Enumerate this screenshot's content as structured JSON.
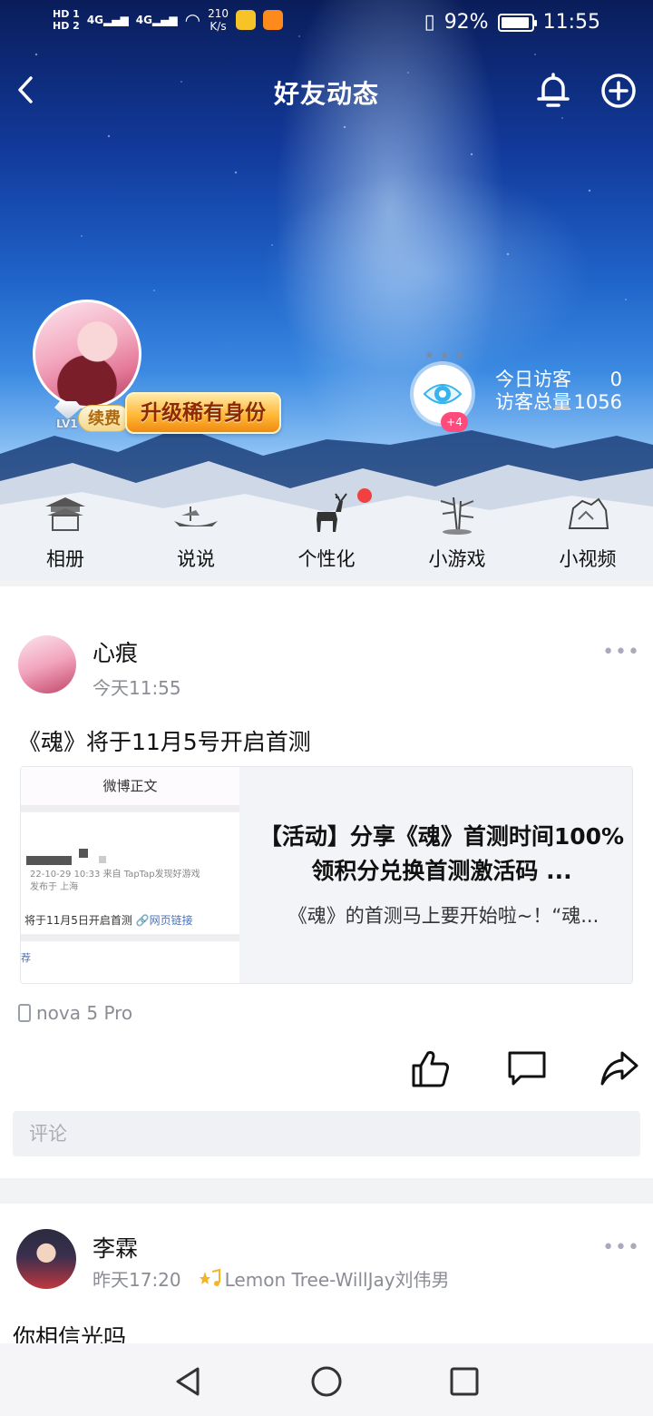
{
  "status_bar": {
    "hd1": "HD 1",
    "hd2": "HD 2",
    "sig1": "4G",
    "sig2": "4G",
    "speed_value": "210",
    "speed_unit": "K/s",
    "battery_pct": "92%",
    "time": "11:55"
  },
  "nav": {
    "title": "好友动态"
  },
  "profile": {
    "level": "LV1",
    "renew_label": "续费",
    "upgrade_label": "升级稀有身份",
    "eye_badge": "+4",
    "today_visitors_label": "今日访客",
    "today_visitors_value": "0",
    "total_visitors_label": "访客总量",
    "total_visitors_value": "1056"
  },
  "categories": [
    {
      "label": "相册"
    },
    {
      "label": "说说"
    },
    {
      "label": "个性化"
    },
    {
      "label": "小游戏"
    },
    {
      "label": "小视频"
    }
  ],
  "post1": {
    "author": "心痕",
    "time": "今天11:55",
    "text": "《魂》将于11月5号开启首测",
    "link": {
      "thumb_header": "微博正文",
      "thumb_meta_1": "22-10-29 10:33  来自 TapTap发现好游戏",
      "thumb_meta_2": "发布于 上海",
      "thumb_line": "将于11月5日开启首测",
      "thumb_link": "🔗网页链接",
      "thumb_rec": "荐",
      "title": "【活动】分享《魂》首测时间100%领积分兑换首测激活码 ...",
      "desc": "《魂》的首测马上要开始啦~！“魂..."
    },
    "device": "nova 5 Pro",
    "comment_placeholder": "评论"
  },
  "post2": {
    "author": "李霖",
    "time": "昨天17:20",
    "song": "Lemon Tree-WillJay刘伟男",
    "text": "你相信光吗"
  },
  "colors": {
    "accent_red": "#f04040",
    "badge_pink": "#ff4a7c",
    "upgrade_orange": "#ffb938"
  }
}
